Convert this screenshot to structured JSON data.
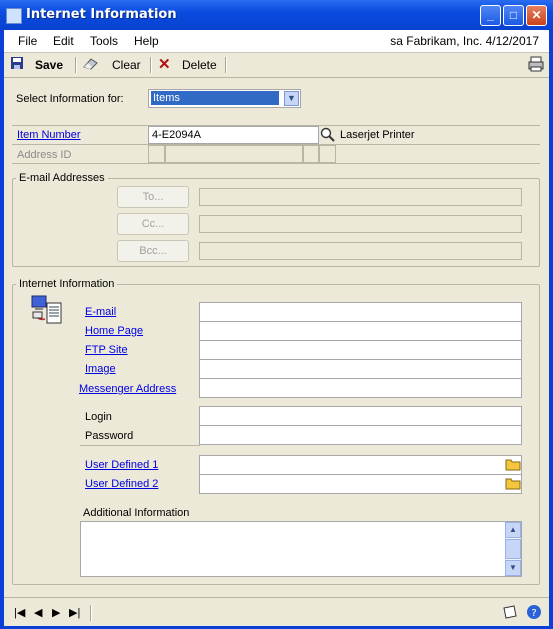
{
  "window": {
    "title": "Internet Information"
  },
  "menu": {
    "file": "File",
    "edit": "Edit",
    "tools": "Tools",
    "help": "Help",
    "info": "sa   Fabrikam, Inc.   4/12/2017"
  },
  "toolbar": {
    "save": "Save",
    "clear": "Clear",
    "delete": "Delete"
  },
  "select_info": {
    "label": "Select Information for:",
    "value": "Items"
  },
  "item": {
    "number_label": "Item Number",
    "number_value": "4-E2094A",
    "description": "Laserjet Printer",
    "address_label": "Address ID"
  },
  "email_addresses": {
    "title": "E-mail Addresses",
    "to": "To...",
    "cc": "Cc...",
    "bcc": "Bcc..."
  },
  "internet_info": {
    "title": "Internet Information",
    "email": "E-mail",
    "home_page": "Home Page",
    "ftp_site": "FTP Site",
    "image": "Image",
    "messenger": "Messenger Address",
    "login": "Login",
    "password": "Password",
    "user_defined_1": "User Defined 1",
    "user_defined_2": "User Defined 2",
    "additional": "Additional Information"
  }
}
